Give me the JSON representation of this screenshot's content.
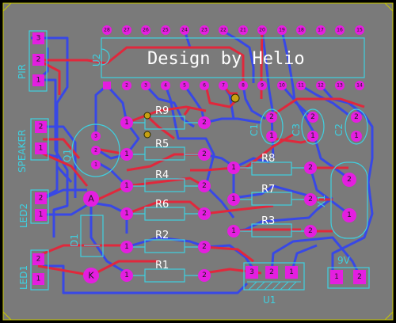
{
  "title": "Design by Helio",
  "colors": {
    "board": "#7a7a7a",
    "top_trace": "#e0283c",
    "bottom_trace": "#3848e6",
    "pad": "#e41ee0",
    "silk": "#3fd0e0",
    "edge": "#c8c800"
  },
  "labels": {
    "pir": "PIR",
    "speaker": "SPEAKER",
    "led2": "LED2",
    "led1": "LED1",
    "u2": "U2",
    "q1": "Q1",
    "d1": "D1",
    "c1": "C1",
    "c2": "C2",
    "c3": "C3",
    "x1": "X1",
    "u1": "U1",
    "nine_v": "9V",
    "r1": "R1",
    "r2": "R2",
    "r3": "R3",
    "r4": "R4",
    "r5": "R5",
    "r6": "R6",
    "r7": "R7",
    "r8": "R8",
    "r9": "R9",
    "anode": "A",
    "cathode": "K"
  },
  "pad_numbers": {
    "n1": "1",
    "n2": "2",
    "n3": "3",
    "n4": "4",
    "n5": "5",
    "n6": "6",
    "n7": "7",
    "n8": "8",
    "n9": "9",
    "n10": "10",
    "n11": "11",
    "n12": "12",
    "n13": "13",
    "n14": "14",
    "n15": "15",
    "n16": "16",
    "n17": "17",
    "n18": "18",
    "n19": "19",
    "n20": "20",
    "n21": "21",
    "n22": "22",
    "n23": "23",
    "n24": "24",
    "n25": "25",
    "n26": "26",
    "n27": "27",
    "n28": "28"
  }
}
